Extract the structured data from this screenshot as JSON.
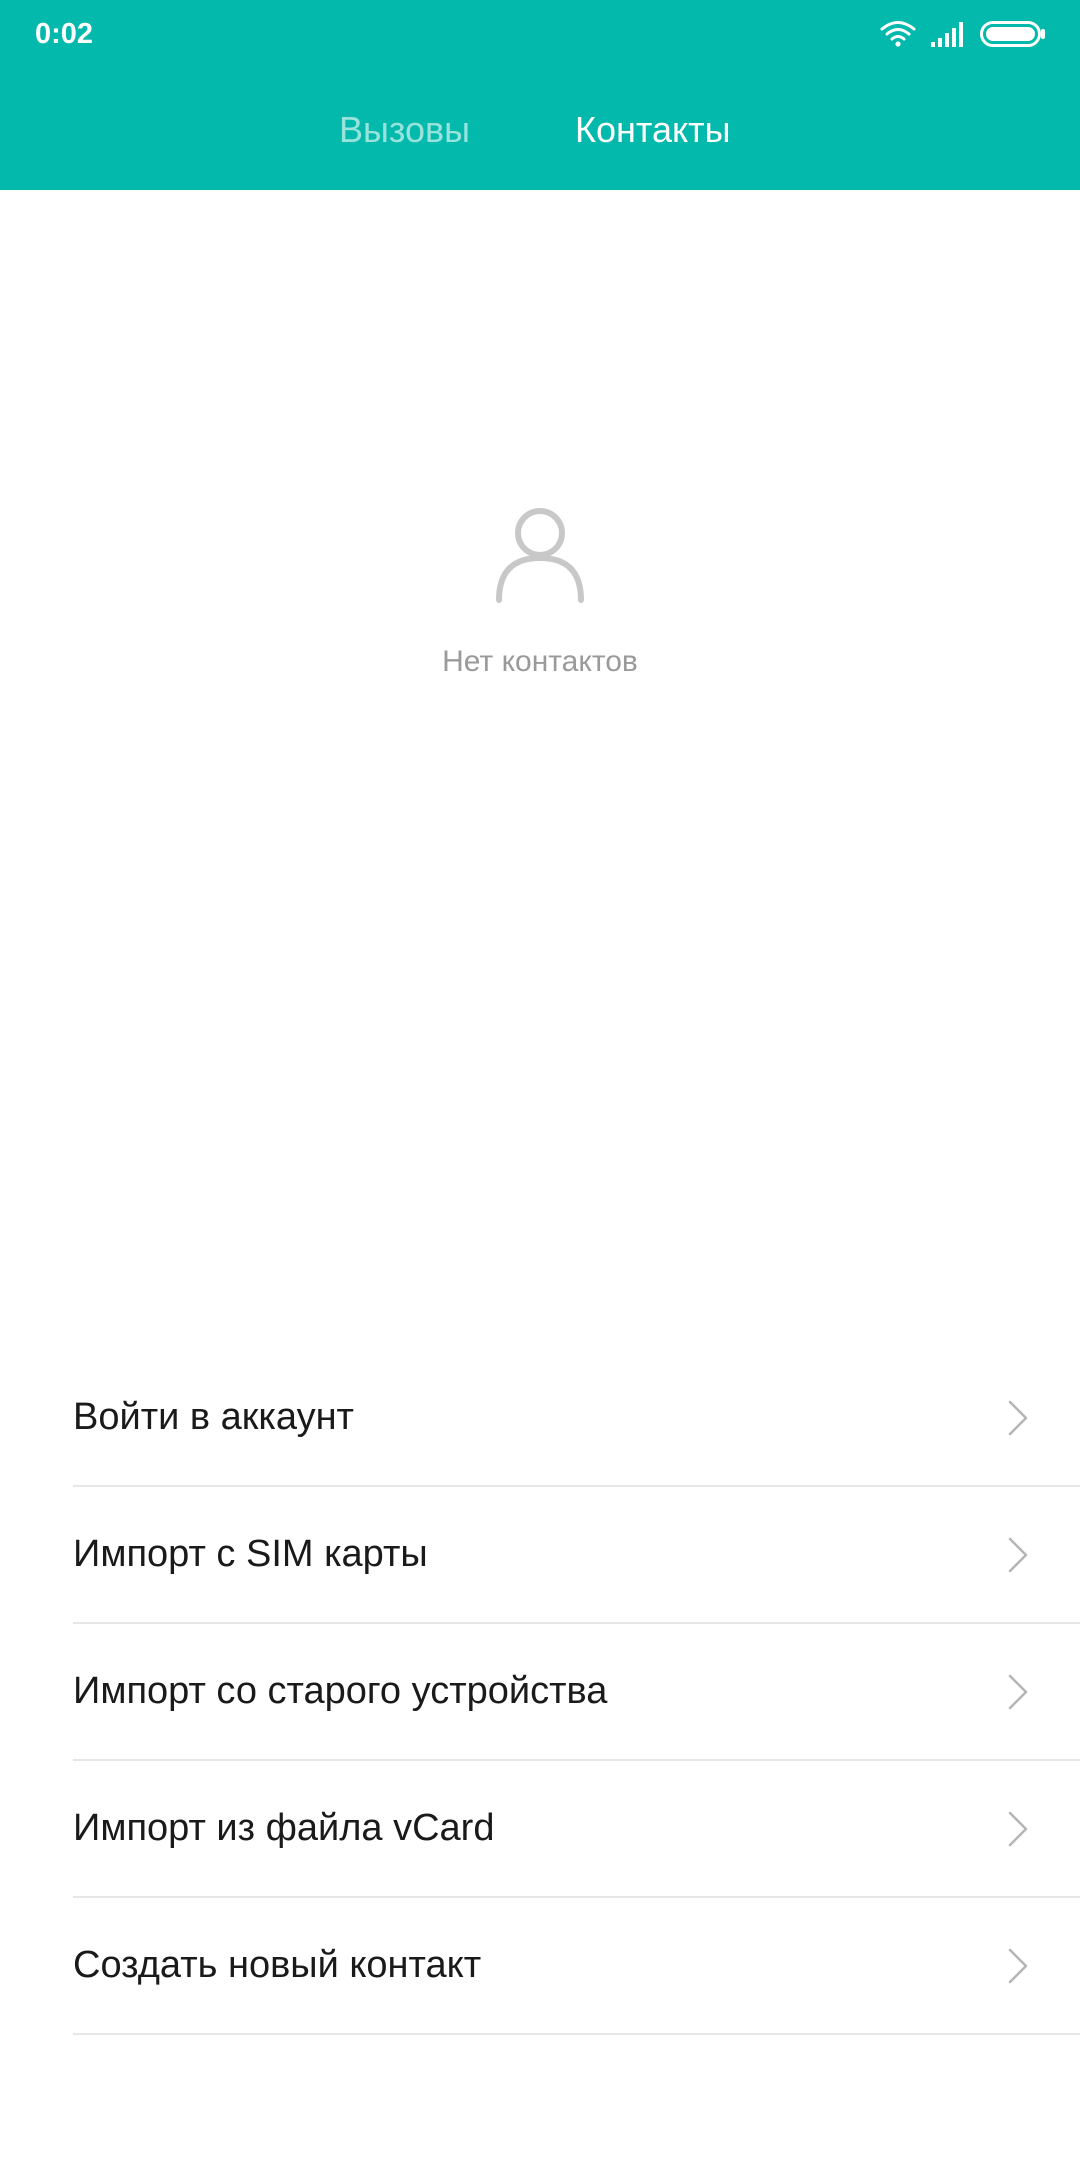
{
  "status_bar": {
    "time": "0:02",
    "icons": [
      "wifi-icon",
      "signal-icon",
      "battery-icon"
    ]
  },
  "tabs": [
    {
      "label": "Вызовы",
      "active": false
    },
    {
      "label": "Контакты",
      "active": true
    }
  ],
  "empty_state": {
    "icon": "person-icon",
    "text": "Нет контактов"
  },
  "menu": [
    {
      "label": "Войти в аккаунт"
    },
    {
      "label": "Импорт с SIM карты"
    },
    {
      "label": "Импорт со старого устройства"
    },
    {
      "label": "Импорт из файла vCard"
    },
    {
      "label": "Создать новый контакт"
    }
  ],
  "colors": {
    "accent": "#02b9ab",
    "background": "#ffffff",
    "muted_text": "#9a9a9a",
    "divider": "#e6e6e6"
  }
}
